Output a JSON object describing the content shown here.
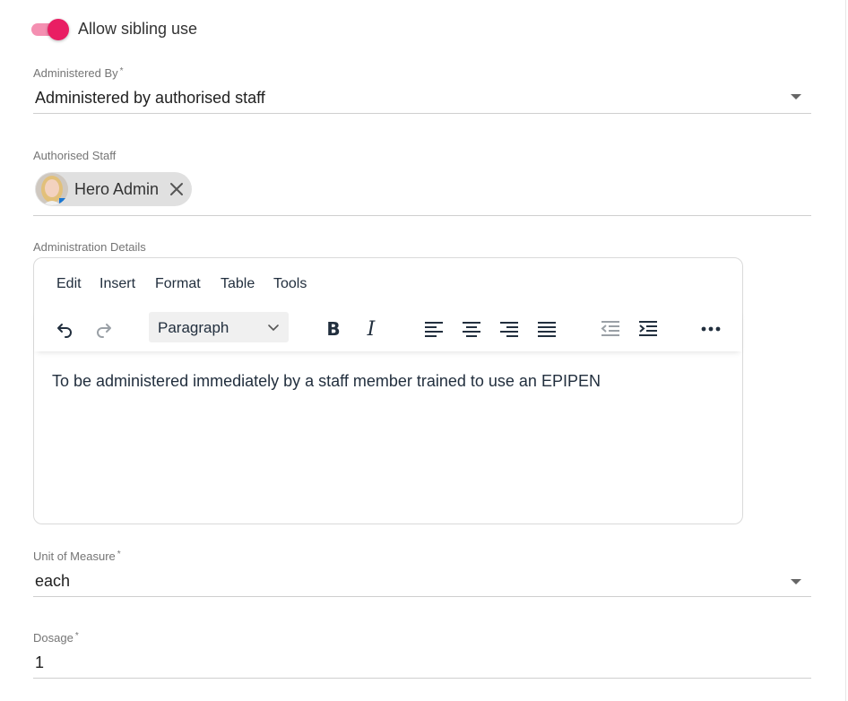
{
  "sibling_toggle": {
    "label": "Allow sibling use",
    "on": true
  },
  "administered_by": {
    "label": "Administered By",
    "required_mark": "*",
    "value": "Administered by authorised staff"
  },
  "authorised_staff": {
    "label": "Authorised Staff",
    "chips": [
      {
        "name": "Hero Admin"
      }
    ]
  },
  "administration_details": {
    "label": "Administration Details",
    "menu": [
      "Edit",
      "Insert",
      "Format",
      "Table",
      "Tools"
    ],
    "block_format": "Paragraph",
    "toolbar_icons": [
      "undo-icon",
      "redo-icon",
      "bold-icon",
      "italic-icon",
      "align-left-icon",
      "align-center-icon",
      "align-right-icon",
      "align-justify-icon",
      "outdent-icon",
      "indent-icon",
      "more-icon"
    ],
    "bold_glyph": "B",
    "italic_glyph": "I",
    "content": "To be administered immediately by a staff member trained to use an EPIPEN"
  },
  "unit_of_measure": {
    "label": "Unit of Measure",
    "required_mark": "*",
    "value": "each"
  },
  "dosage": {
    "label": "Dosage",
    "required_mark": "*",
    "value": "1"
  },
  "colors": {
    "accent": "#e91e63",
    "accent_light": "#f48fb1",
    "label": "#757575",
    "divider": "#cfcfcf"
  }
}
